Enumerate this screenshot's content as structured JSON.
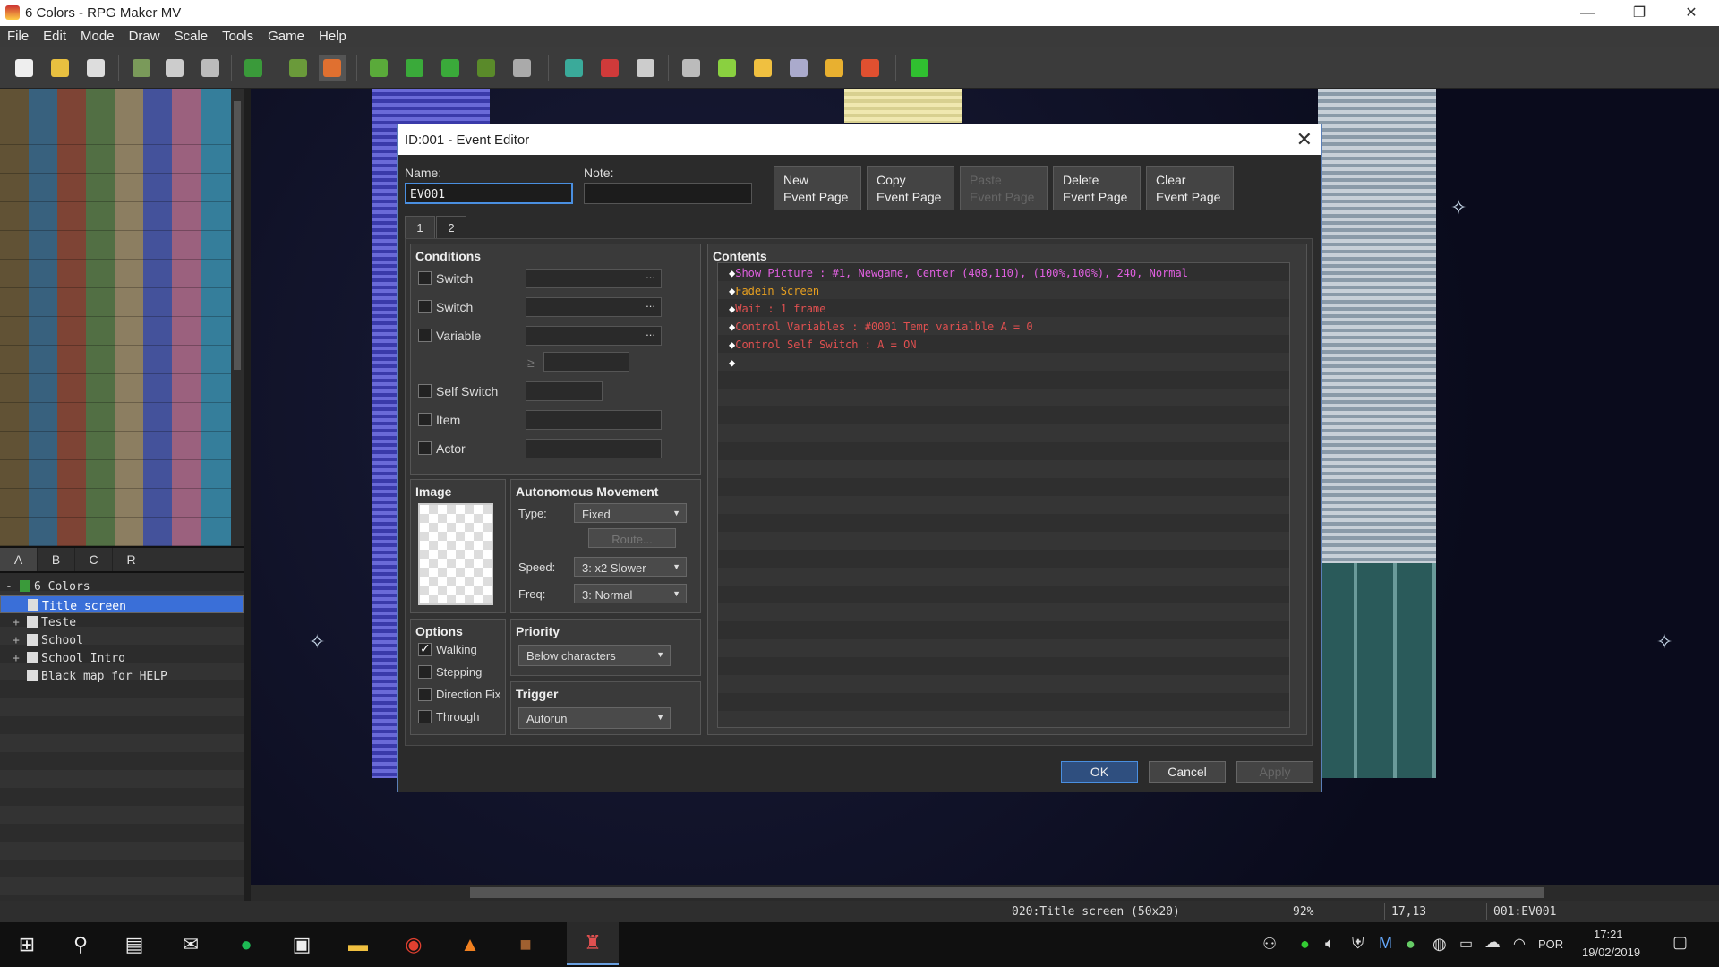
{
  "window": {
    "title": "6 Colors - RPG Maker MV",
    "minimize": "—",
    "restore": "❐",
    "close": "✕"
  },
  "menu": [
    "File",
    "Edit",
    "Mode",
    "Draw",
    "Scale",
    "Tools",
    "Game",
    "Help"
  ],
  "toolbar": {
    "icons": [
      "new-project-icon",
      "open-project-icon",
      "save-project-icon",
      "cut-icon",
      "copy-icon",
      "paste-icon",
      "undo-icon",
      "map-mode-icon",
      "event-mode-icon",
      "pencil-icon",
      "rectangle-icon",
      "ellipse-icon",
      "fill-icon",
      "shadow-pen-icon",
      "zoom-in-icon",
      "zoom-out-icon",
      "actual-size-icon",
      "database-icon",
      "plugin-manager-icon",
      "sound-test-icon",
      "event-searcher-icon",
      "resource-manager-icon",
      "character-generator-icon",
      "playtest-icon"
    ],
    "colors": [
      "#eee",
      "#e8c040",
      "#ddd",
      "#7a9a5a",
      "#ccc",
      "#bbb",
      "#3a9a3a",
      "#6a9a3a",
      "#e07030",
      "#5aaa3a",
      "#3aaa3a",
      "#3aaa3a",
      "#5a8a2a",
      "#aaa",
      "#3aaa9a",
      "#d03a3a",
      "#ccc",
      "#bbb",
      "#8ad040",
      "#f0c040",
      "#aac",
      "#e8b030",
      "#e05030",
      "#30c030"
    ]
  },
  "palette_tabs": [
    "A",
    "B",
    "C",
    "R"
  ],
  "map_tree": [
    {
      "label": "6 Colors",
      "exp": "-",
      "selected": false,
      "root": true
    },
    {
      "label": "Title screen",
      "exp": "",
      "selected": true
    },
    {
      "label": "Teste",
      "exp": "+",
      "selected": false
    },
    {
      "label": "School",
      "exp": "+",
      "selected": false
    },
    {
      "label": "School Intro",
      "exp": "+",
      "selected": false
    },
    {
      "label": "Black map for HELP",
      "exp": "",
      "selected": false
    }
  ],
  "status": {
    "map": "020:Title screen (50x20)",
    "zoom": "92%",
    "coords": "17,13",
    "event": "001:EV001"
  },
  "dialog": {
    "title": "ID:001 - Event Editor",
    "close": "✕",
    "name_label": "Name:",
    "name_value": "EV001",
    "note_label": "Note:",
    "note_value": "",
    "page_buttons": [
      {
        "l1": "New",
        "l2": "Event Page",
        "disabled": false
      },
      {
        "l1": "Copy",
        "l2": "Event Page",
        "disabled": false
      },
      {
        "l1": "Paste",
        "l2": "Event Page",
        "disabled": true
      },
      {
        "l1": "Delete",
        "l2": "Event Page",
        "disabled": false
      },
      {
        "l1": "Clear",
        "l2": "Event Page",
        "disabled": false
      }
    ],
    "page_tabs": [
      "1",
      "2"
    ],
    "conditions": {
      "title": "Conditions",
      "switch1": "Switch",
      "switch2": "Switch",
      "variable": "Variable",
      "gte": "≥",
      "self_switch": "Self Switch",
      "item": "Item",
      "actor": "Actor",
      "dots": "..."
    },
    "image": {
      "title": "Image"
    },
    "movement": {
      "title": "Autonomous Movement",
      "type_label": "Type:",
      "type_value": "Fixed",
      "route": "Route...",
      "speed_label": "Speed:",
      "speed_value": "3: x2 Slower",
      "freq_label": "Freq:",
      "freq_value": "3: Normal"
    },
    "options": {
      "title": "Options",
      "walking": "Walking",
      "stepping": "Stepping",
      "direction_fix": "Direction Fix",
      "through": "Through",
      "walking_checked": true
    },
    "priority": {
      "title": "Priority",
      "value": "Below characters"
    },
    "trigger": {
      "title": "Trigger",
      "value": "Autorun"
    },
    "contents": {
      "title": "Contents",
      "commands": [
        {
          "text": "Show Picture : #1, Newgame, Center (408,110), (100%,100%), 240, Normal",
          "color": "#e060e0"
        },
        {
          "text": "Fadein Screen",
          "color": "#e8a020"
        },
        {
          "text": "Wait : 1 frame",
          "color": "#e05050"
        },
        {
          "text": "Control Variables : #0001 Temp varialble A = 0",
          "color": "#e05050"
        },
        {
          "text": "Control Self Switch : A = ON",
          "color": "#e05050"
        },
        {
          "text": "",
          "color": "#fff"
        }
      ],
      "diamond": "◆"
    },
    "ok": "OK",
    "cancel": "Cancel",
    "apply": "Apply"
  },
  "taskbar": {
    "time": "17:21",
    "date": "19/02/2019",
    "lang": "POR"
  }
}
